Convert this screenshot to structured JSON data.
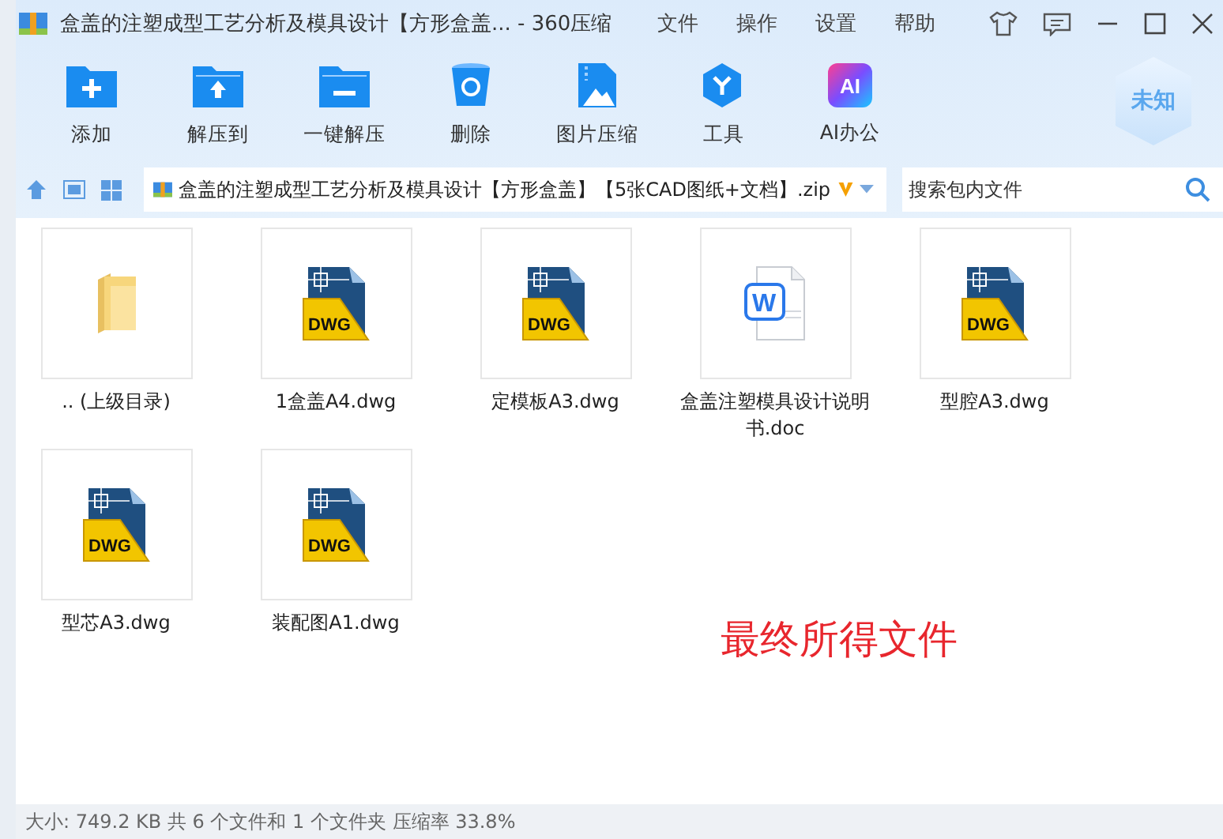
{
  "window": {
    "title": "盒盖的注塑成型工艺分析及模具设计【方形盒盖... - 360压缩"
  },
  "menu": [
    "文件",
    "操作",
    "设置",
    "帮助"
  ],
  "toolbar": [
    {
      "label": "添加",
      "kind": "add"
    },
    {
      "label": "解压到",
      "kind": "extract"
    },
    {
      "label": "一键解压",
      "kind": "oneclick"
    },
    {
      "label": "删除",
      "kind": "delete"
    },
    {
      "label": "图片压缩",
      "kind": "image"
    },
    {
      "label": "工具",
      "kind": "tools"
    },
    {
      "label": "AI办公",
      "kind": "ai",
      "badge": "AI"
    }
  ],
  "shield": "未知",
  "path": "盒盖的注塑成型工艺分析及模具设计【方形盒盖】【5张CAD图纸+文档】.zip",
  "search": {
    "placeholder": "搜索包内文件"
  },
  "files": [
    {
      "name": ".. (上级目录)",
      "kind": "folder"
    },
    {
      "name": "1盒盖A4.dwg",
      "kind": "dwg",
      "badge": "DWG"
    },
    {
      "name": "定模板A3.dwg",
      "kind": "dwg",
      "badge": "DWG"
    },
    {
      "name": "盒盖注塑模具设计说明书.doc",
      "kind": "doc",
      "badge": "W"
    },
    {
      "name": "型腔A3.dwg",
      "kind": "dwg",
      "badge": "DWG"
    },
    {
      "name": "型芯A3.dwg",
      "kind": "dwg",
      "badge": "DWG"
    },
    {
      "name": "装配图A1.dwg",
      "kind": "dwg",
      "badge": "DWG"
    }
  ],
  "annotation": "最终所得文件",
  "status_bar": "大小: 749.2 KB 共 6 个文件和 1 个文件夹 压缩率 33.8%"
}
